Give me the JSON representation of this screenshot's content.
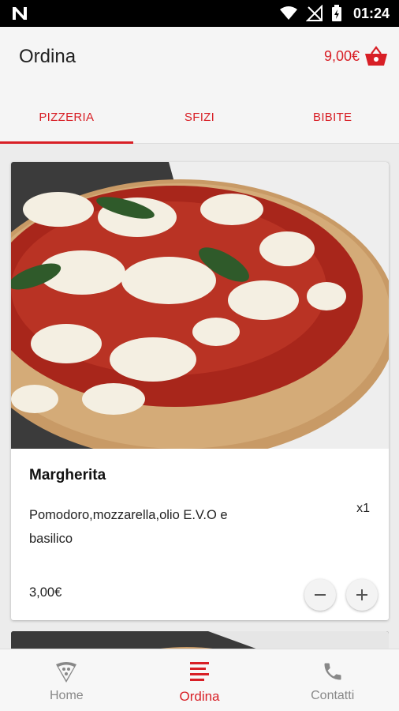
{
  "status_bar": {
    "time": "01:24"
  },
  "app_bar": {
    "title": "Ordina",
    "cart_total": "9,00€"
  },
  "tabs": [
    {
      "label": "PIZZERIA",
      "active": true
    },
    {
      "label": "SFIZI",
      "active": false
    },
    {
      "label": "BIBITE",
      "active": false
    }
  ],
  "products": [
    {
      "name": "Margherita",
      "description": "Pomodoro,mozzarella,olio E.V.O e basilico",
      "quantity": "x1",
      "price": "3,00€"
    }
  ],
  "bottom_nav": [
    {
      "label": "Home",
      "icon": "pizza-icon",
      "active": false
    },
    {
      "label": "Ordina",
      "icon": "menu-list-icon",
      "active": true
    },
    {
      "label": "Contatti",
      "icon": "phone-icon",
      "active": false
    }
  ],
  "colors": {
    "accent": "#d81f26",
    "inactive": "#888888"
  }
}
